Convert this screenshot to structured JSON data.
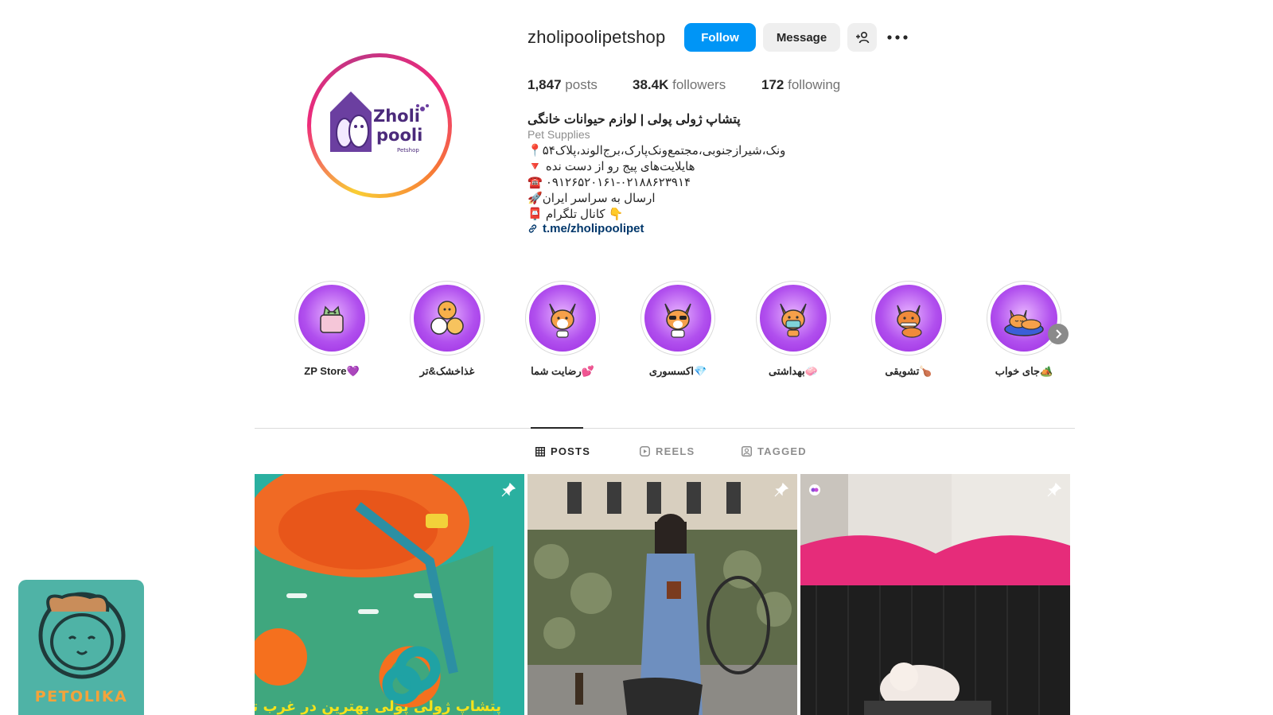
{
  "profile": {
    "username": "zholipoolipetshop",
    "follow_label": "Follow",
    "message_label": "Message",
    "posts_count": "1,847",
    "posts_label": "posts",
    "followers_count": "38.4K",
    "followers_label": "followers",
    "following_count": "172",
    "following_label": "following",
    "avatar_logo_line1": "Zholi",
    "avatar_logo_line2": "pooli",
    "avatar_logo_sub": "Petshop"
  },
  "bio": {
    "name": "پتشاپ ژولی پولی | لوازم حیوانات خانگی",
    "category": "Pet Supplies",
    "line1": "📍ونک،شیرازجنوبی،مجتمع‌ونک‌پارک،برج‌الوند،پلاک۵۴",
    "line2": "🔻 هایلایت‌های پیج رو از دست نده",
    "line3": "☎️ ۰۹۱۲۶۵۲۰۱۶۱-۰۲۱۸۸۶۲۳۹۱۴",
    "line4": "🚀ارسال به سراسر ایران",
    "line5": "📮 کانال تلگرام 👇",
    "link": "t.me/zholipoolipet"
  },
  "highlights": [
    {
      "label": "ZP Store💜",
      "icon": "cat-sweater-icon"
    },
    {
      "label": "غذاخشک&تر",
      "icon": "dog-cat-pile-icon"
    },
    {
      "label": "رضایت شما💕",
      "icon": "corgi-happy-icon"
    },
    {
      "label": "اکسسوری💎",
      "icon": "corgi-sunglasses-icon"
    },
    {
      "label": "بهداشتی🧼",
      "icon": "corgi-mask-icon"
    },
    {
      "label": "تشویقی🍗",
      "icon": "shiba-bone-icon"
    },
    {
      "label": "جای خواب🏕️",
      "icon": "corgi-sleeping-icon"
    }
  ],
  "tabs": [
    {
      "label": "POSTS",
      "active": true
    },
    {
      "label": "REELS",
      "active": false
    },
    {
      "label": "TAGGED",
      "active": false
    }
  ],
  "posts": [
    {
      "caption": "پتشاپ ژولی پولی بهترین در غرب تهران",
      "pinned": true
    },
    {
      "caption": "",
      "pinned": true
    },
    {
      "caption": "",
      "pinned": true
    }
  ],
  "watermark": {
    "text": "PETOLIKA"
  },
  "colors": {
    "accent": "#0095f6",
    "highlight_purple": "#b150ee",
    "link": "#00376b"
  }
}
